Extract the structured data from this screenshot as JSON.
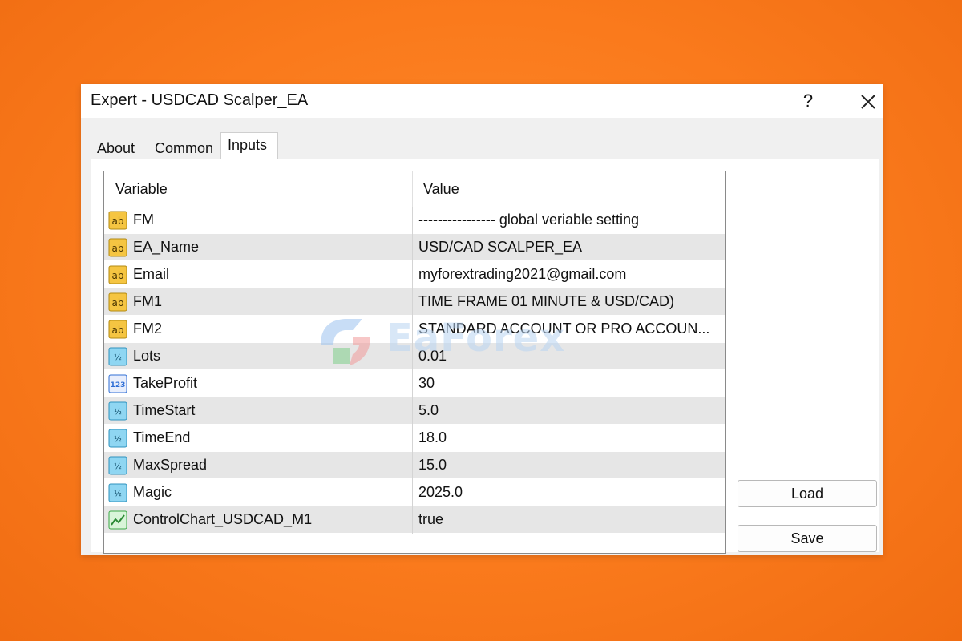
{
  "window": {
    "title": "Expert - USDCAD Scalper_EA",
    "help": "?",
    "close": "close"
  },
  "tabs": [
    {
      "label": "About",
      "active": false
    },
    {
      "label": "Common",
      "active": false
    },
    {
      "label": "Inputs",
      "active": true
    }
  ],
  "table": {
    "headers": {
      "variable": "Variable",
      "value": "Value"
    },
    "rows": [
      {
        "icon": "string-ab-icon",
        "name": "FM",
        "value": "---------------- global veriable setting"
      },
      {
        "icon": "string-ab-icon",
        "name": "EA_Name",
        "value": "USD/CAD SCALPER_EA"
      },
      {
        "icon": "string-ab-icon",
        "name": "Email",
        "value": "myforextrading2021@gmail.com"
      },
      {
        "icon": "string-ab-icon",
        "name": "FM1",
        "value": "TIME FRAME 01 MINUTE & USD/CAD)"
      },
      {
        "icon": "string-ab-icon",
        "name": "FM2",
        "value": "STANDARD ACCOUNT OR PRO ACCOUN..."
      },
      {
        "icon": "double-half-icon",
        "name": "Lots",
        "value": "0.01"
      },
      {
        "icon": "integer-123-icon",
        "name": "TakeProfit",
        "value": "30"
      },
      {
        "icon": "double-half-icon",
        "name": "TimeStart",
        "value": "5.0"
      },
      {
        "icon": "double-half-icon",
        "name": "TimeEnd",
        "value": "18.0"
      },
      {
        "icon": "double-half-icon",
        "name": "MaxSpread",
        "value": "15.0"
      },
      {
        "icon": "double-half-icon",
        "name": "Magic",
        "value": "2025.0"
      },
      {
        "icon": "bool-chart-icon",
        "name": "ControlChart_USDCAD_M1",
        "value": "true"
      }
    ]
  },
  "buttons": {
    "load": "Load",
    "save": "Save"
  },
  "watermark": {
    "text": "EaForex"
  },
  "colors": {
    "background": "#fa7a1c",
    "string_icon": "#f5c542",
    "double_icon": "#5fc0e8",
    "integer_icon": "#2f6fd6",
    "bool_icon": "#3aa845"
  }
}
